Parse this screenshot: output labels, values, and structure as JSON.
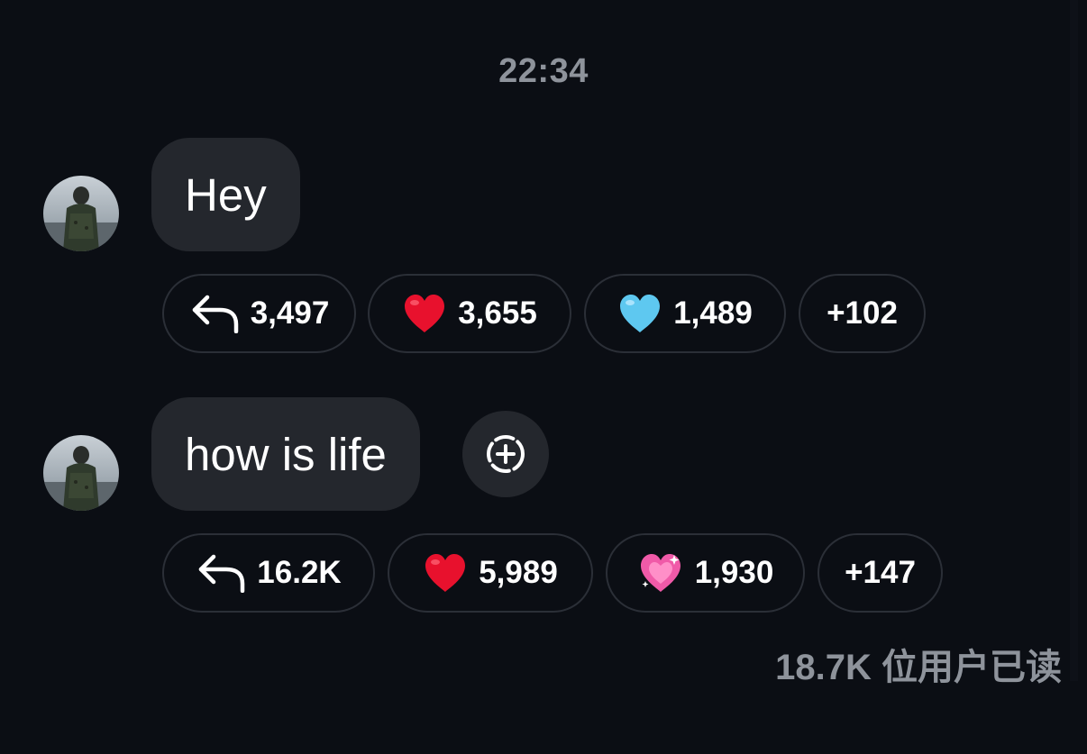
{
  "timestamp": "22:34",
  "messages": [
    {
      "text": "Hey",
      "reactions": {
        "replies": "3,497",
        "items": [
          {
            "icon": "red-heart-icon",
            "count": "3,655"
          },
          {
            "icon": "light-blue-heart-icon",
            "count": "1,489"
          }
        ],
        "more": "+102"
      }
    },
    {
      "text": "how is life",
      "reactions": {
        "replies": "16.2K",
        "items": [
          {
            "icon": "red-heart-icon",
            "count": "5,989"
          },
          {
            "icon": "sparkling-pink-heart-icon",
            "count": "1,930"
          }
        ],
        "more": "+147"
      }
    }
  ],
  "read_receipt": "18.7K 位用户已读",
  "colors": {
    "background": "#0b0e14",
    "bubble": "#24272d",
    "chip_border": "#2b2f37",
    "muted_text": "#8e939b",
    "red_heart": "#e8112d",
    "light_blue_heart": "#5ec8f0",
    "pink_heart": "#f05aa8"
  }
}
